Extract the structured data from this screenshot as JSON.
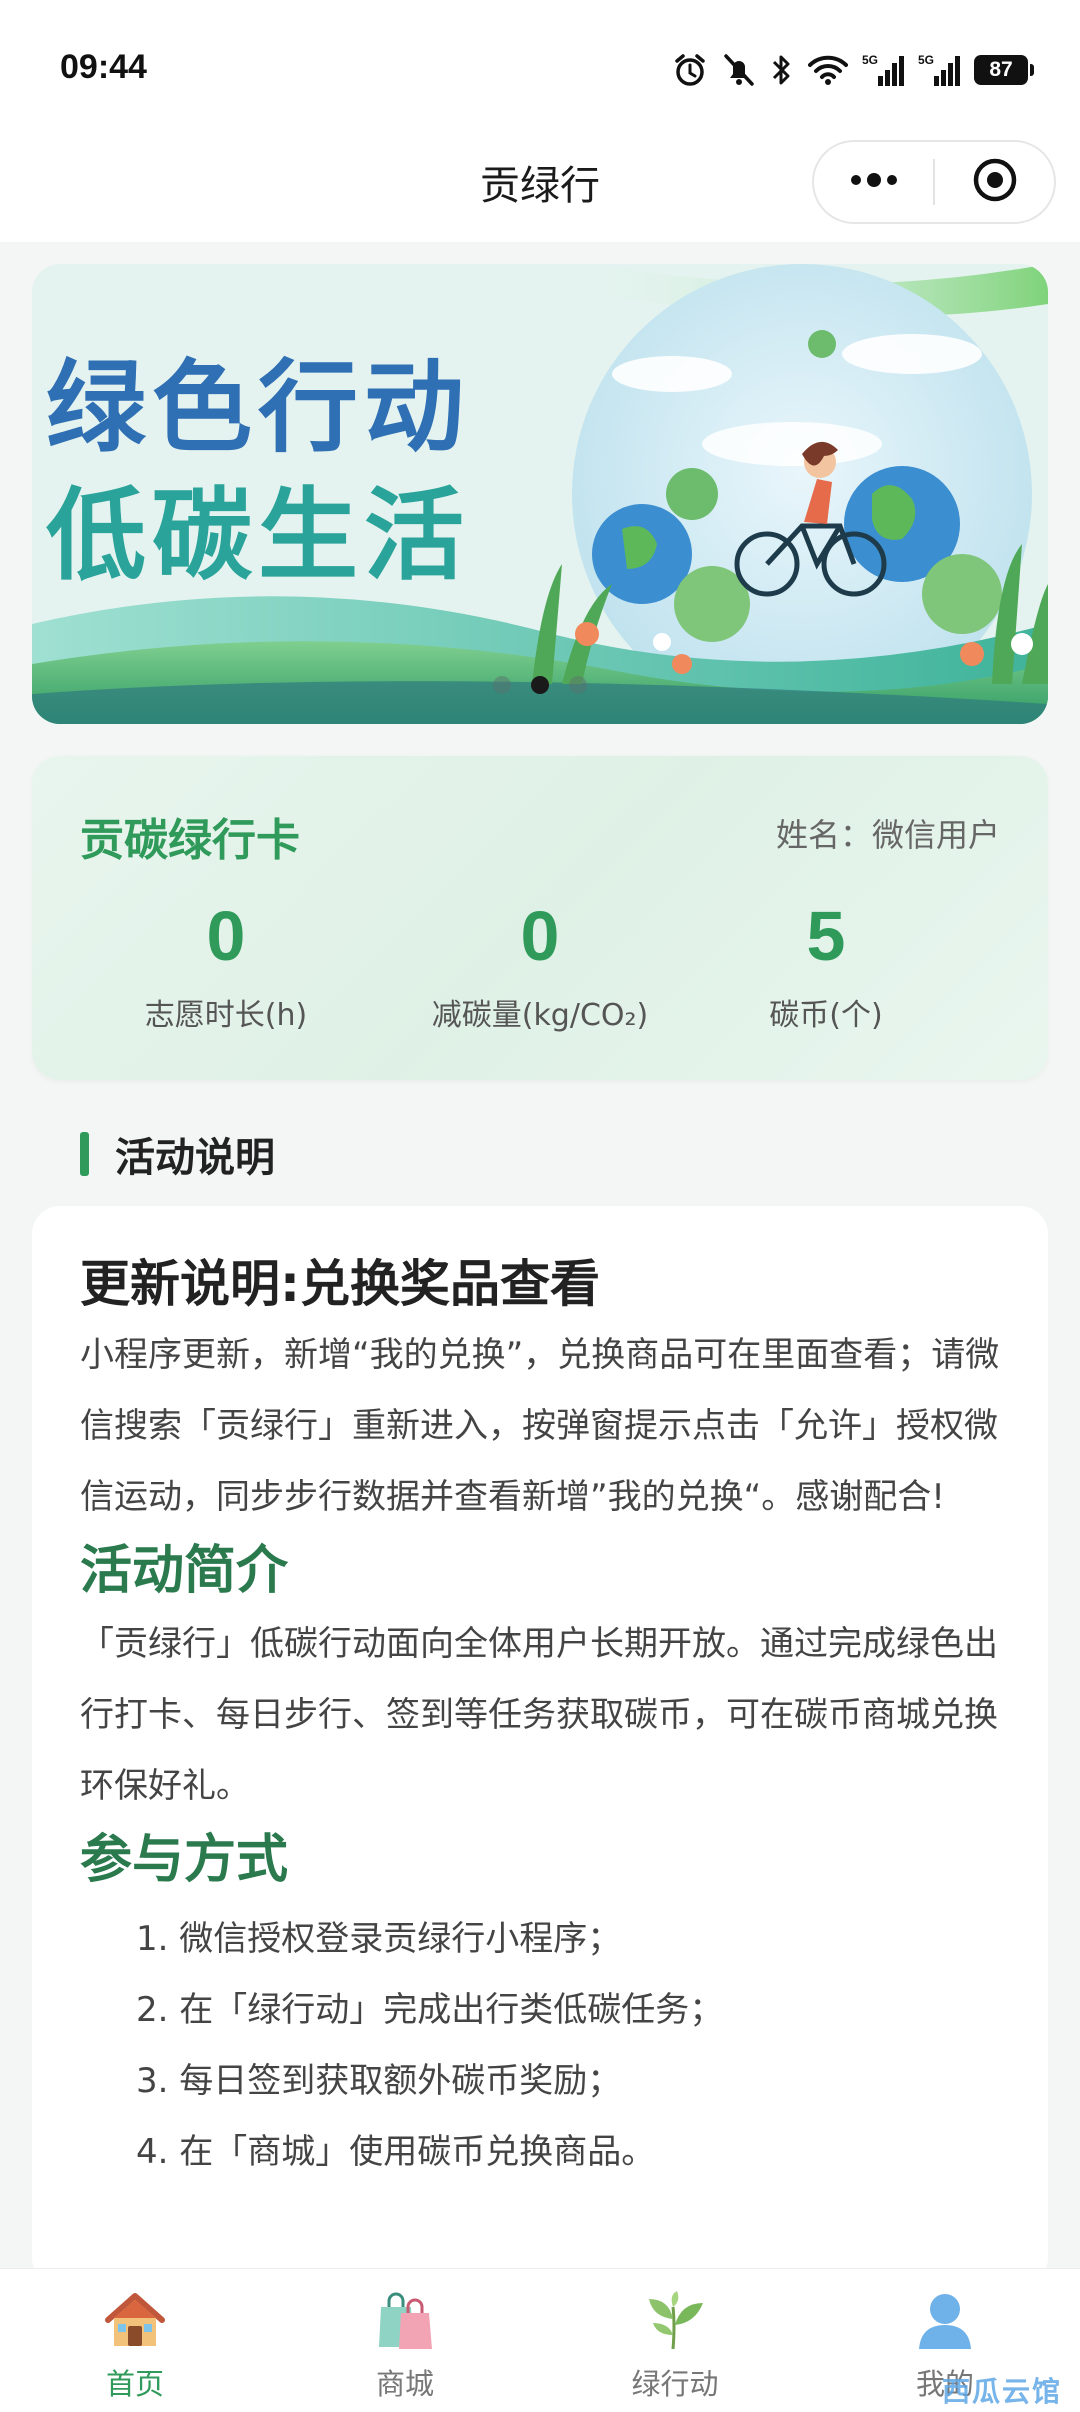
{
  "status_bar": {
    "time": "09:44",
    "battery": "87",
    "icons": [
      "alarm-icon",
      "mute-icon",
      "bluetooth-icon",
      "wifi-icon",
      "5g-signal-icon",
      "5g-signal-icon",
      "battery-icon"
    ]
  },
  "nav": {
    "title": "贡绿行",
    "more_icon": "more-dots-icon",
    "close_icon": "target-circle-icon"
  },
  "banner": {
    "line1": "绿色行动",
    "line2": "低碳生活",
    "slide_count": 3,
    "active_slide": 2
  },
  "card": {
    "title": "贡碳绿行卡",
    "user_label": "姓名：微信用户",
    "stats": [
      {
        "value": "0",
        "label": "志愿时长(h)"
      },
      {
        "value": "0",
        "label": "减碳量(kg/CO₂)"
      },
      {
        "value": "5",
        "label": "碳币(个)"
      }
    ]
  },
  "section": {
    "title": "活动说明"
  },
  "content": {
    "update_title": "更新说明:兑换奖品查看",
    "update_text": "小程序更新，新增“我的兑换”，兑换商品可在里面查看；请微信搜索「贡绿行」重新进入，按弹窗提示点击「允许」授权微信运动，同步步行数据并查看新增”我的兑换“。感谢配合!",
    "intro_title": "活动简介",
    "intro_text": "「贡绿行」低碳行动面向全体用户长期开放。通过完成绿色出行打卡、每日步行、签到等任务获取碳币，可在碳币商城兑换环保好礼。",
    "join_title": "参与方式",
    "steps": [
      "1. 微信授权登录贡绿行小程序；",
      "2. 在「绿行动」完成出行类低碳任务；",
      "3. 每日签到获取额外碳币奖励；",
      "4. 在「商城」使用碳币兑换商品。"
    ]
  },
  "tabs": [
    {
      "label": "首页",
      "icon": "home-icon",
      "active": true
    },
    {
      "label": "商城",
      "icon": "shopping-bag-icon",
      "active": false
    },
    {
      "label": "绿行动",
      "icon": "leaf-icon",
      "active": false
    },
    {
      "label": "我的",
      "icon": "user-icon",
      "active": false
    }
  ],
  "watermark": "西瓜云馆",
  "colors": {
    "accent": "#2f9a5a",
    "heading_green": "#2a7a4e",
    "banner_blue": "#2f6fb4",
    "banner_teal": "#2aa39a"
  }
}
